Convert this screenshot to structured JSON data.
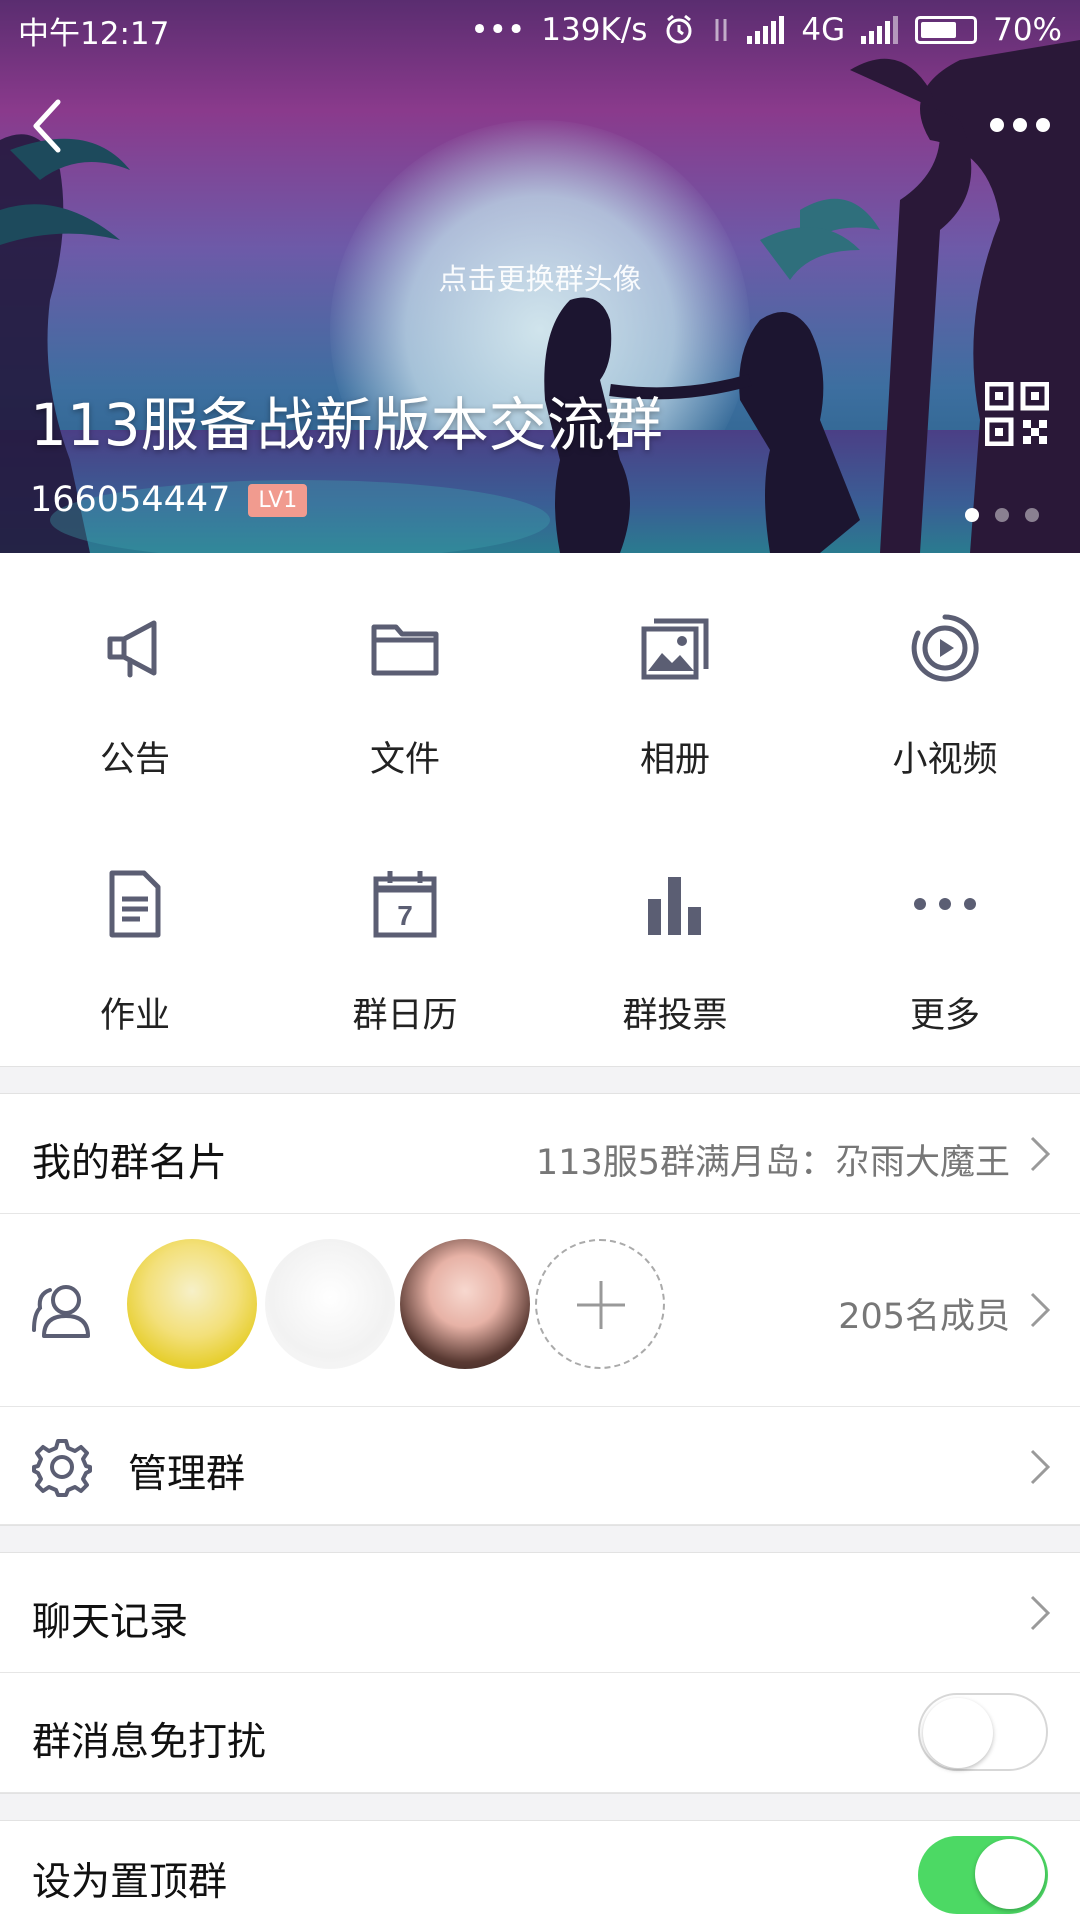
{
  "status_bar": {
    "time": "中午12:17",
    "network_speed": "139K/s",
    "network_type": "4G",
    "battery_percent": "70%",
    "battery_level": 0.7
  },
  "header": {
    "change_avatar_hint": "点击更换群头像",
    "group_name": "113服备战新版本交流群",
    "group_id": "166054447",
    "level_badge": "LV1",
    "page_count": 3,
    "active_page": 1
  },
  "grid": {
    "items": [
      {
        "label": "公告",
        "icon": "announcement-icon"
      },
      {
        "label": "文件",
        "icon": "folder-icon"
      },
      {
        "label": "相册",
        "icon": "album-icon"
      },
      {
        "label": "小视频",
        "icon": "video-icon"
      },
      {
        "label": "作业",
        "icon": "homework-icon"
      },
      {
        "label": "群日历",
        "icon": "calendar-icon"
      },
      {
        "label": "群投票",
        "icon": "vote-icon"
      },
      {
        "label": "更多",
        "icon": "more-icon"
      }
    ],
    "calendar_day": "7"
  },
  "list": {
    "group_card_label": "我的群名片",
    "group_card_value": "113服5群满月岛：尕雨大魔王",
    "member_count": "205名成员",
    "manage_label": "管理群",
    "chat_history_label": "聊天记录",
    "mute_label": "群消息免打扰",
    "mute_enabled": false,
    "pin_label": "设为置顶群",
    "pin_enabled": true
  },
  "colors": {
    "icon_gray": "#5b5e73",
    "toggle_on": "#4cd964",
    "badge": "#f19b8f"
  }
}
